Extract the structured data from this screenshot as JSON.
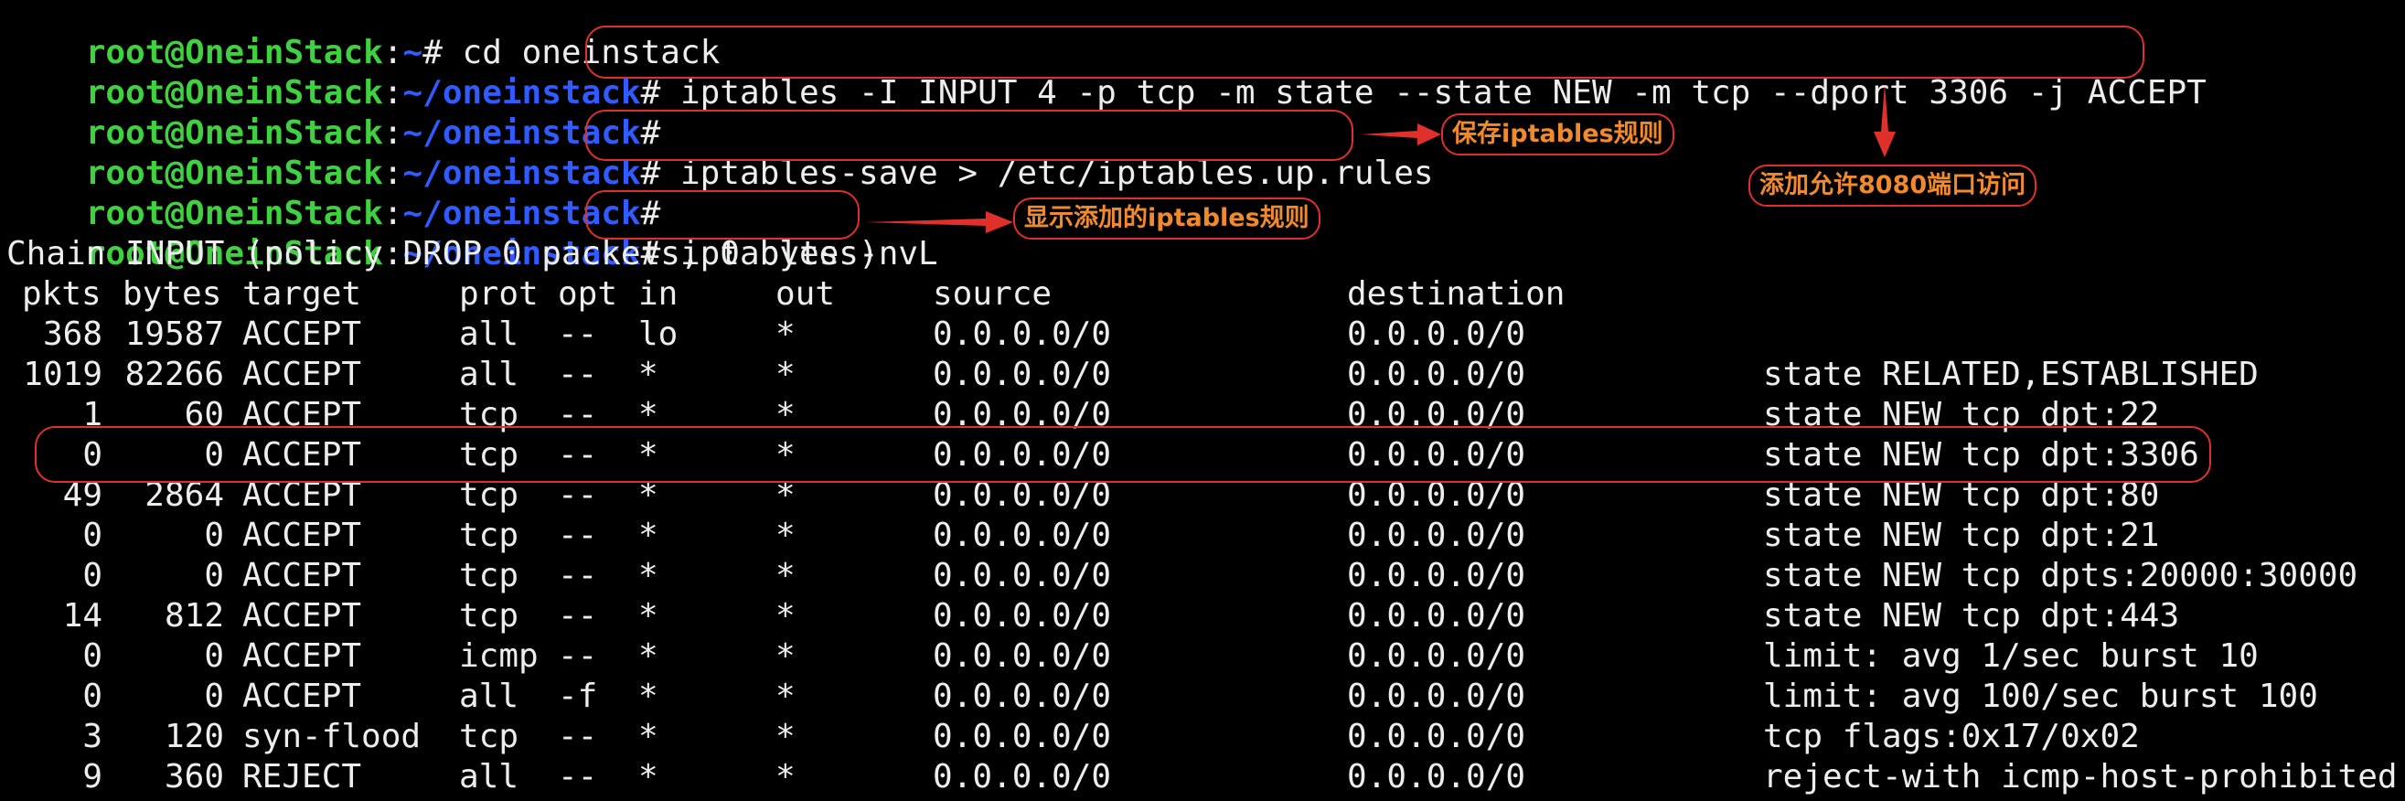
{
  "prompt": {
    "user": "root@OneinStack",
    "sep": ":",
    "home": "~",
    "path": "~/oneinstack",
    "symbol": "#"
  },
  "commands": [
    {
      "path_type": "home",
      "text": " cd oneinstack"
    },
    {
      "path_type": "path",
      "text": " iptables -I INPUT 4 -p tcp -m state --state NEW -m tcp --dport 3306 -j ACCEPT"
    },
    {
      "path_type": "path",
      "text": ""
    },
    {
      "path_type": "path",
      "text": " iptables-save > /etc/iptables.up.rules"
    },
    {
      "path_type": "path",
      "text": ""
    },
    {
      "path_type": "path",
      "text": " iptables -nvL"
    }
  ],
  "chain_header": "Chain INPUT (policy DROP 0 packets, 0 bytes)",
  "table": {
    "headers": {
      "pkts": "pkts",
      "bytes": "bytes",
      "target": "target",
      "prot": "prot",
      "opt": "opt",
      "in": "in",
      "out": "out",
      "source": "source",
      "destination": "destination"
    },
    "rows": [
      {
        "pkts": "368",
        "bytes": "19587",
        "target": "ACCEPT",
        "prot": "all",
        "opt": "--",
        "in": "lo",
        "out": "*",
        "source": "0.0.0.0/0",
        "destination": "0.0.0.0/0",
        "extra": ""
      },
      {
        "pkts": "1019",
        "bytes": "82266",
        "target": "ACCEPT",
        "prot": "all",
        "opt": "--",
        "in": "*",
        "out": "*",
        "source": "0.0.0.0/0",
        "destination": "0.0.0.0/0",
        "extra": "state RELATED,ESTABLISHED"
      },
      {
        "pkts": "1",
        "bytes": "60",
        "target": "ACCEPT",
        "prot": "tcp",
        "opt": "--",
        "in": "*",
        "out": "*",
        "source": "0.0.0.0/0",
        "destination": "0.0.0.0/0",
        "extra": "state NEW tcp dpt:22"
      },
      {
        "pkts": "0",
        "bytes": "0",
        "target": "ACCEPT",
        "prot": "tcp",
        "opt": "--",
        "in": "*",
        "out": "*",
        "source": "0.0.0.0/0",
        "destination": "0.0.0.0/0",
        "extra": "state NEW tcp dpt:3306"
      },
      {
        "pkts": "49",
        "bytes": "2864",
        "target": "ACCEPT",
        "prot": "tcp",
        "opt": "--",
        "in": "*",
        "out": "*",
        "source": "0.0.0.0/0",
        "destination": "0.0.0.0/0",
        "extra": "state NEW tcp dpt:80"
      },
      {
        "pkts": "0",
        "bytes": "0",
        "target": "ACCEPT",
        "prot": "tcp",
        "opt": "--",
        "in": "*",
        "out": "*",
        "source": "0.0.0.0/0",
        "destination": "0.0.0.0/0",
        "extra": "state NEW tcp dpt:21"
      },
      {
        "pkts": "0",
        "bytes": "0",
        "target": "ACCEPT",
        "prot": "tcp",
        "opt": "--",
        "in": "*",
        "out": "*",
        "source": "0.0.0.0/0",
        "destination": "0.0.0.0/0",
        "extra": "state NEW tcp dpts:20000:30000"
      },
      {
        "pkts": "14",
        "bytes": "812",
        "target": "ACCEPT",
        "prot": "tcp",
        "opt": "--",
        "in": "*",
        "out": "*",
        "source": "0.0.0.0/0",
        "destination": "0.0.0.0/0",
        "extra": "state NEW tcp dpt:443"
      },
      {
        "pkts": "0",
        "bytes": "0",
        "target": "ACCEPT",
        "prot": "icmp",
        "opt": "--",
        "in": "*",
        "out": "*",
        "source": "0.0.0.0/0",
        "destination": "0.0.0.0/0",
        "extra": "limit: avg 1/sec burst 10"
      },
      {
        "pkts": "0",
        "bytes": "0",
        "target": "ACCEPT",
        "prot": "all",
        "opt": "-f",
        "in": "*",
        "out": "*",
        "source": "0.0.0.0/0",
        "destination": "0.0.0.0/0",
        "extra": "limit: avg 100/sec burst 100"
      },
      {
        "pkts": "3",
        "bytes": "120",
        "target": "syn-flood",
        "prot": "tcp",
        "opt": "--",
        "in": "*",
        "out": "*",
        "source": "0.0.0.0/0",
        "destination": "0.0.0.0/0",
        "extra": "tcp flags:0x17/0x02"
      },
      {
        "pkts": "9",
        "bytes": "360",
        "target": "REJECT",
        "prot": "all",
        "opt": "--",
        "in": "*",
        "out": "*",
        "source": "0.0.0.0/0",
        "destination": "0.0.0.0/0",
        "extra": "reject-with icmp-host-prohibited"
      }
    ]
  },
  "annotations": {
    "save_rules": "保存iptables规则",
    "allow_port": "添加允许8080端口访问",
    "show_rules": "显示添加的iptables规则"
  },
  "colors": {
    "prompt_user": "#3fd13f",
    "prompt_path": "#2f5bff",
    "text": "#ededed",
    "highlight": "#e0302c",
    "annotation_text": "#f08a2c",
    "background": "#000000"
  },
  "icons": [
    "arrow-right-icon",
    "arrow-down-icon"
  ]
}
